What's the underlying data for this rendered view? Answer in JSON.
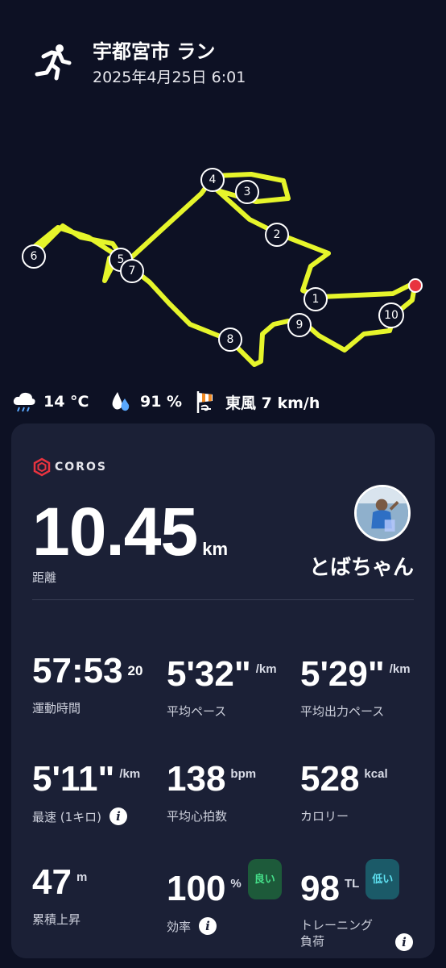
{
  "header": {
    "title": "宇都宮市 ラン",
    "datetime": "2025年4月25日 6:01",
    "icon": "running-person-icon"
  },
  "map": {
    "route_color": "#e6f52b",
    "end_marker_color": "#e8333f",
    "km_markers": [
      "1",
      "2",
      "3",
      "4",
      "5",
      "6",
      "7",
      "8",
      "9",
      "10"
    ]
  },
  "weather": {
    "temperature": "14 °C",
    "humidity": "91 %",
    "wind": "東風 7 km/h",
    "icons": [
      "rain-cloud-icon",
      "water-drops-icon",
      "windsock-icon"
    ]
  },
  "card": {
    "brand": "COROS",
    "distance": {
      "value": "10.45",
      "unit": "km",
      "label": "距離"
    },
    "user": {
      "name": "とばちゃん"
    },
    "stats": [
      {
        "value": "57:53",
        "sup": "20",
        "unit": "",
        "label": "運動時間"
      },
      {
        "value": "5'32\"",
        "unit": "/km",
        "label": "平均ペース"
      },
      {
        "value": "5'29\"",
        "unit": "/km",
        "label": "平均出力ペース"
      },
      {
        "value": "5'11\"",
        "unit": "/km",
        "label": "最速 (1キロ)"
      },
      {
        "value": "138",
        "unit": "bpm",
        "label": "平均心拍数"
      },
      {
        "value": "528",
        "unit": "kcal",
        "label": "カロリー"
      },
      {
        "value": "47",
        "unit": "m",
        "label": "累積上昇"
      },
      {
        "value": "100",
        "unit": "%",
        "badge": "良い",
        "label": "効率"
      },
      {
        "value": "98",
        "unit": "TL",
        "badge": "低い",
        "label": "トレーニング",
        "label2": "負荷"
      }
    ]
  },
  "colors": {
    "background": "#0d1124",
    "card": "#1b2036",
    "good": "#45e08a",
    "low": "#5fe2f2"
  }
}
